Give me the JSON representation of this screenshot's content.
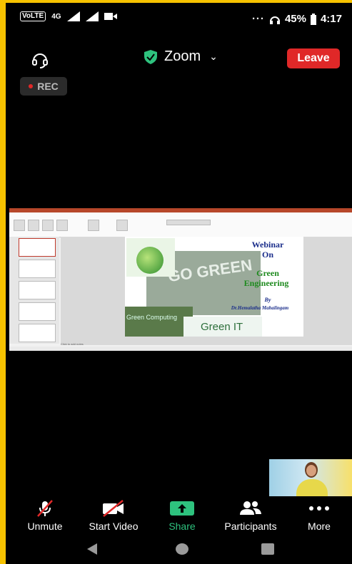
{
  "status_bar": {
    "network_label": "VoLTE",
    "signal_label": "4G",
    "more": "···",
    "battery": "45%",
    "time": "4:17"
  },
  "header": {
    "app_title": "Zoom",
    "leave_label": "Leave",
    "rec_label": "REC",
    "colors": {
      "leave": "#e02828",
      "secure_shield": "#2ec27e"
    }
  },
  "shared_slide": {
    "title_line1": "Webinar",
    "title_line2": "On",
    "topic_line1": "Green",
    "topic_line2": "Engineering",
    "by": "By",
    "author": "Dr.Hemalatha Mahalingam",
    "image_caption_left": "Green Computing",
    "image_caption_right": "Green IT",
    "go_green": "GO GREEN"
  },
  "controls": [
    {
      "id": "unmute",
      "label": "Unmute",
      "icon": "mic-off-icon"
    },
    {
      "id": "start-video",
      "label": "Start Video",
      "icon": "video-off-icon"
    },
    {
      "id": "share",
      "label": "Share",
      "icon": "share-icon"
    },
    {
      "id": "participants",
      "label": "Participants",
      "icon": "participants-icon"
    },
    {
      "id": "more",
      "label": "More",
      "icon": "more-icon"
    }
  ]
}
